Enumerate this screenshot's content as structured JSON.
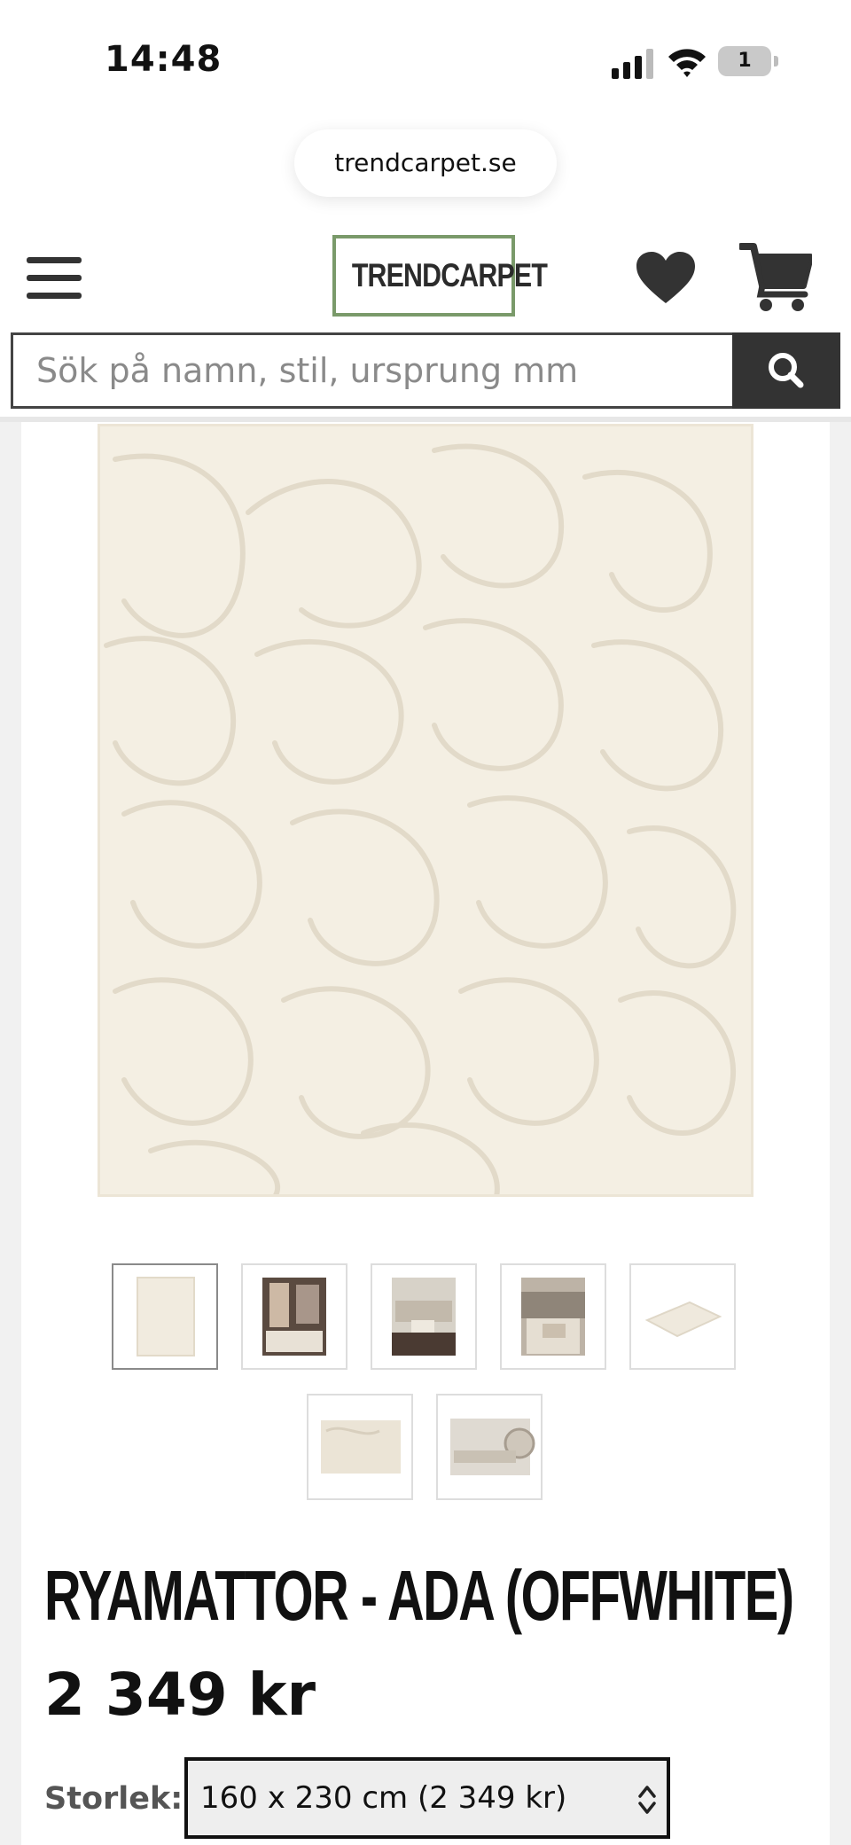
{
  "status_bar": {
    "time": "14:48",
    "battery_level": "1"
  },
  "browser": {
    "url": "trendcarpet.se"
  },
  "header": {
    "logo_text": "TRENDCARPET",
    "logo_color": "#7a9a6a",
    "menu_icon": "hamburger-menu-icon",
    "wishlist_icon": "heart-icon",
    "cart_icon": "shopping-cart-icon"
  },
  "search": {
    "placeholder": "Sök på namn, stil, ursprung mm",
    "button_icon": "search-icon"
  },
  "gallery": {
    "main_image": "rug-offwhite-main-image",
    "thumbnails": [
      {
        "name": "thumb-rug-front",
        "active": true
      },
      {
        "name": "thumb-room-bedroom"
      },
      {
        "name": "thumb-room-living-1"
      },
      {
        "name": "thumb-room-living-2"
      },
      {
        "name": "thumb-rug-angle"
      },
      {
        "name": "thumb-rug-detail"
      },
      {
        "name": "thumb-rug-rolled"
      }
    ]
  },
  "product": {
    "title": "RYAMATTOR - ADA (OFFWHITE)",
    "price": "2 349 kr",
    "size_label": "Storlek:",
    "size_selected": "160 x 230 cm (2 349 kr)"
  }
}
